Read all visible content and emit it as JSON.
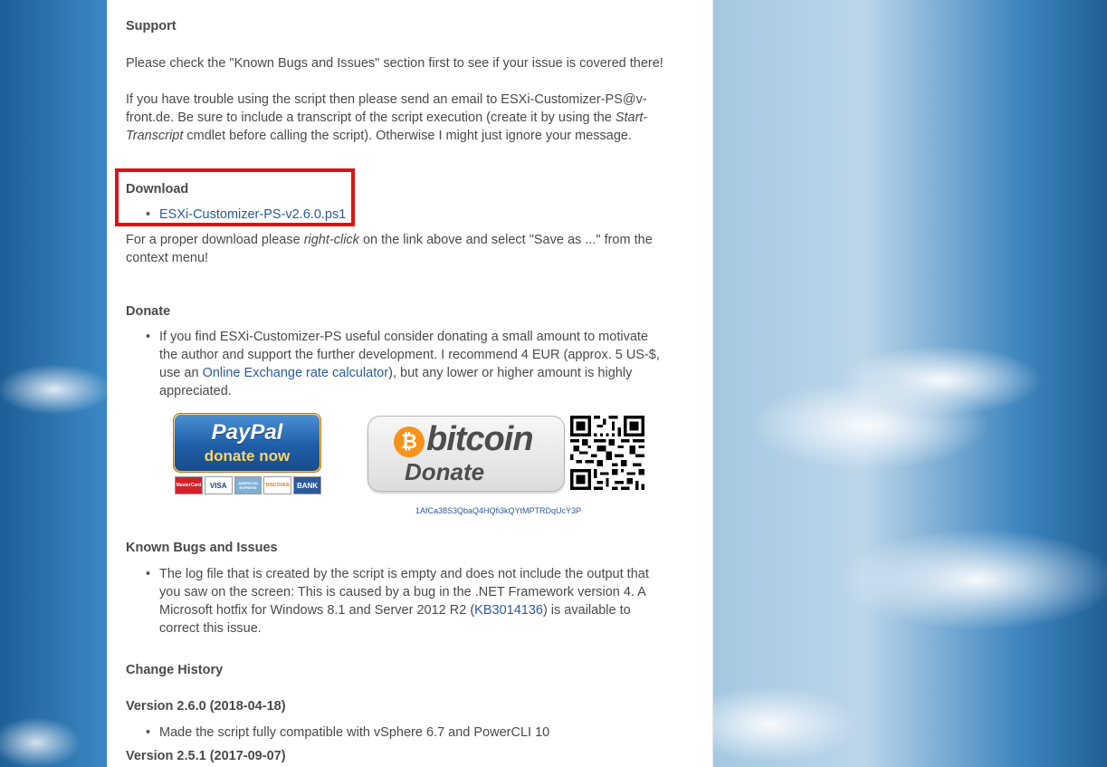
{
  "support": {
    "heading": "Support",
    "p1": "Please check the \"Known Bugs and Issues\" section first to see if your issue is covered there!",
    "p2_line1": "If you have trouble using the script then please send an email to ESXi-Customizer-PS@v-",
    "p2_line2_a": "front.de. Be sure to include a transcript of the script execution (create it by using the ",
    "p2_line2_em": "Start-",
    "p2_line3_em": "Transcript",
    "p2_line3_b": " cmdlet before calling the script). Otherwise I might just ignore your message."
  },
  "download": {
    "heading": "Download",
    "link_label": "ESXi-Customizer-PS-v2.6.0.ps1",
    "note_a": "For a proper download please ",
    "note_em": "right-click",
    "note_b": " on the link above and select \"Save as ...\" from the",
    "note_line2": "context menu!"
  },
  "donate": {
    "heading": "Donate",
    "text_a": "If you find ESXi-Customizer-PS useful consider donating a small amount to motivate the author and support the further development. I recommend 4 EUR (approx. 5 US-$, use an ",
    "link": "Online Exchange rate calculator",
    "text_b": "), but any lower or higher amount is highly appreciated.",
    "paypal": {
      "name": "PayPal",
      "sub": "donate now",
      "cards": [
        "MasterCard",
        "VISA",
        "AMERICAN EXPRESS",
        "DISCOVER",
        "BANK"
      ]
    },
    "bitcoin": {
      "word": "bitcoin",
      "coin_symbol": "₿",
      "donate": "Donate",
      "address": "1AfCa38S3QbaQ4HQfi3kQYtMPTRDqUcY3P"
    }
  },
  "bugs": {
    "heading": "Known Bugs and Issues",
    "text_a": "The log file that is created by the script is empty and does not include the output that you saw on the screen: This is caused by a bug in the .NET Framework version 4. A Microsoft hotfix for Windows 8.1 and Server 2012 R2 (",
    "link": "KB3014136",
    "text_b": ") is available to correct this issue."
  },
  "history": {
    "heading": "Change History",
    "v1_heading": "Version 2.6.0 (2018-04-18)",
    "v1_item": "Made the script fully compatible with vSphere 6.7 and PowerCLI 10",
    "v2_heading": "Version 2.5.1 (2017-09-07)"
  },
  "colors": {
    "highlight_box": "#e01212",
    "link": "#2a5a9e",
    "bitcoin_orange": "#f7931a"
  }
}
